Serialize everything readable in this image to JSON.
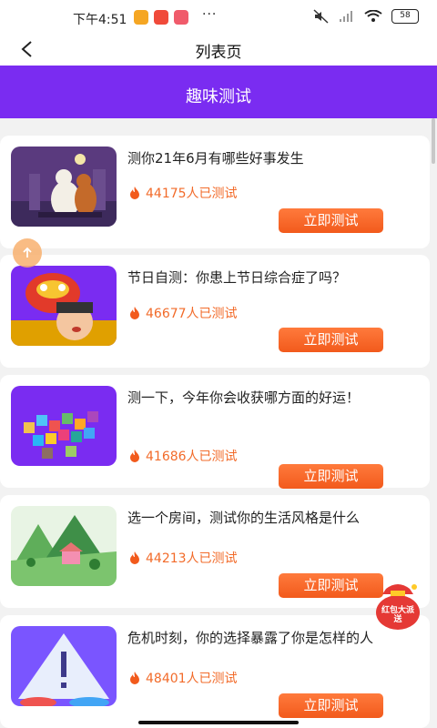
{
  "status_bar": {
    "time": "下午4:51",
    "dots": "···",
    "battery": "58"
  },
  "nav": {
    "title": "列表页"
  },
  "section": {
    "title": "趣味测试"
  },
  "items": [
    {
      "title": "测你21年6月有哪些好事发生",
      "count": "44175人已测试",
      "button": "立即测试",
      "image": "cats-night-illustration"
    },
    {
      "title": "节日自测：你患上节日综合症了吗？",
      "count": "46677人已测试",
      "button": "立即测试",
      "image": "lion-dance-illustration"
    },
    {
      "title": "测一下，今年你会收获哪方面的好运！",
      "count": "41686人已测试",
      "button": "立即测试",
      "image": "colorful-cubes-illustration"
    },
    {
      "title": "选一个房间，测试你的生活风格是什么",
      "count": "44213人已测试",
      "button": "立即测试",
      "image": "mountain-house-illustration"
    },
    {
      "title": "危机时刻，你的选择暴露了你是怎样的人",
      "count": "48401人已测试",
      "button": "立即测试",
      "image": "warning-sign-illustration"
    }
  ],
  "float": {
    "red_packet": "红包大派送"
  },
  "colors": {
    "accent": "#7a2cf1",
    "button": "#f2641f",
    "count": "#f26b2a"
  }
}
